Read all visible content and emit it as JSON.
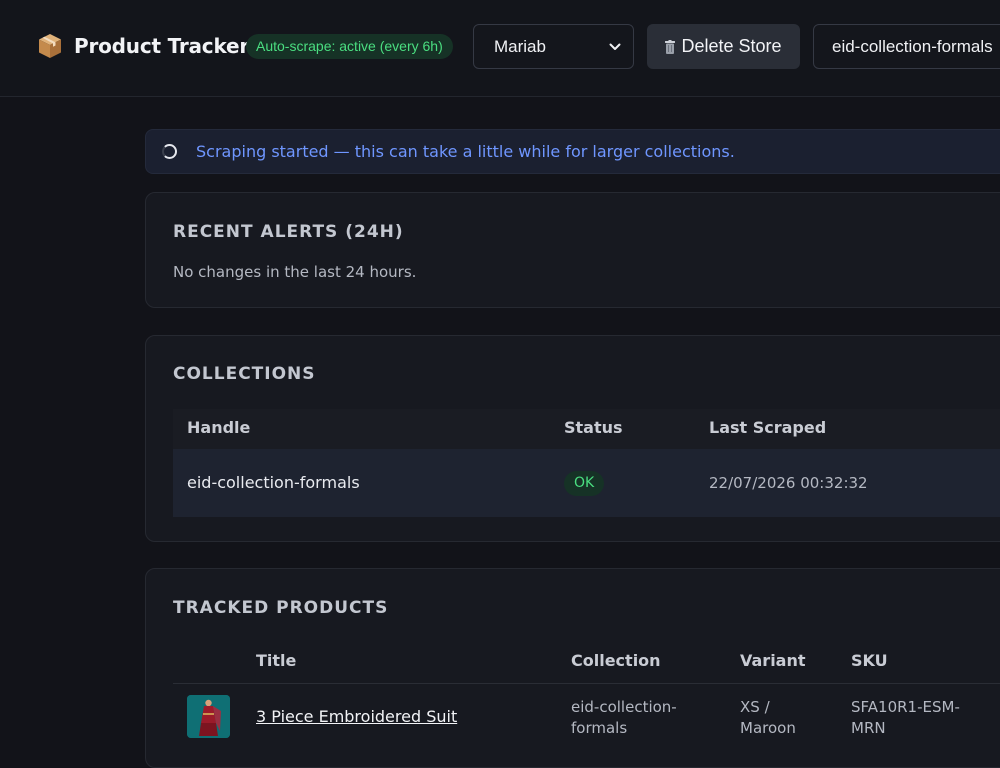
{
  "header": {
    "title": "Product Tracker",
    "auto_scrape_badge": "Auto-scrape: active (every 6h)",
    "store_select": {
      "value": "Mariab"
    },
    "delete_button": "Delete Store",
    "collection_input": {
      "value": "eid-collection-formals"
    }
  },
  "banner": {
    "text": "Scraping started — this can take a little while for larger collections."
  },
  "alerts": {
    "title": "RECENT ALERTS (24H)",
    "empty_text": "No changes in the last 24 hours."
  },
  "collections": {
    "title": "COLLECTIONS",
    "columns": [
      "Handle",
      "Status",
      "Last Scraped"
    ],
    "rows": [
      {
        "handle": "eid-collection-formals",
        "status": "OK",
        "last_scraped": "22/07/2026 00:32:32"
      }
    ]
  },
  "products": {
    "title": "TRACKED PRODUCTS",
    "columns": [
      "Title",
      "Collection",
      "Variant",
      "SKU"
    ],
    "rows": [
      {
        "title": "3 Piece Embroidered Suit",
        "collection_line1": "eid-collection-",
        "collection_line2": "formals",
        "variant_line1": "XS /",
        "variant_line2": "Maroon",
        "sku_line1": "SFA10R1-ESM-",
        "sku_line2": "MRN"
      }
    ]
  },
  "colors": {
    "accent_green": "#4ade80",
    "banner_text": "#6f96ff",
    "background": "#121319"
  }
}
